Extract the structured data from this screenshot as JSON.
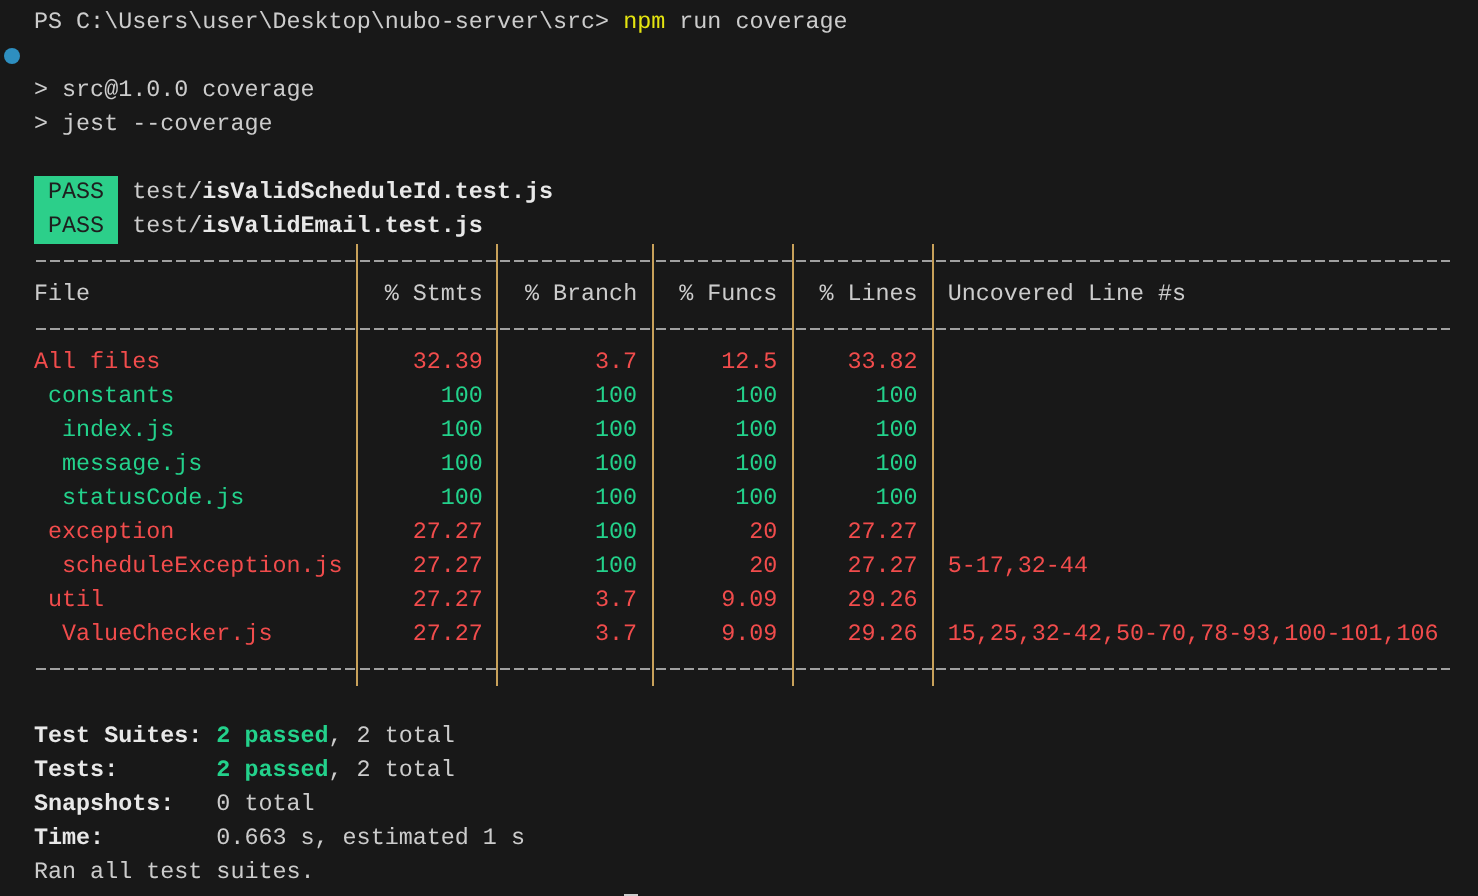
{
  "prompt": {
    "path": "PS C:\\Users\\user\\Desktop\\nubo-server\\src>",
    "command": "npm",
    "args": "run coverage"
  },
  "script_lines": [
    "> src@1.0.0 coverage",
    "> jest --coverage"
  ],
  "results": [
    {
      "badge": "PASS",
      "path": "test/**isValidScheduleId.test.js**"
    },
    {
      "badge": "PASS",
      "path": "test/**isValidEmail.test.js**"
    }
  ],
  "coverage_table": {
    "columns": [
      "File",
      "% Stmts",
      "% Branch",
      "% Funcs",
      "% Lines",
      "Uncovered Line #s"
    ],
    "rows": [
      {
        "cells": [
          {
            "text": "All files",
            "color": "#f14c4c"
          },
          {
            "text": "32.39",
            "color": "#f14c4c"
          },
          {
            "text": "3.7",
            "color": "#f14c4c"
          },
          {
            "text": "12.5",
            "color": "#f14c4c"
          },
          {
            "text": "33.82",
            "color": "#f14c4c"
          }
        ],
        "children": [
          {
            "cells": [
              {
                "text": "constants",
                "color": "#23d18b"
              },
              {
                "text": "100",
                "color": "#23d18b"
              },
              {
                "text": "100",
                "color": "#23d18b"
              },
              {
                "text": "100",
                "color": "#23d18b"
              },
              {
                "text": "100",
                "color": "#23d18b"
              }
            ],
            "children": [
              {
                "cells": [
                  {
                    "text": "index.js",
                    "color": "#23d18b"
                  },
                  {
                    "text": "100",
                    "color": "#23d18b"
                  },
                  {
                    "text": "100",
                    "color": "#23d18b"
                  },
                  {
                    "text": "100",
                    "color": "#23d18b"
                  },
                  {
                    "text": "100",
                    "color": "#23d18b"
                  }
                ]
              },
              {
                "cells": [
                  {
                    "text": "message.js",
                    "color": "#23d18b"
                  },
                  {
                    "text": "100",
                    "color": "#23d18b"
                  },
                  {
                    "text": "100",
                    "color": "#23d18b"
                  },
                  {
                    "text": "100",
                    "color": "#23d18b"
                  },
                  {
                    "text": "100",
                    "color": "#23d18b"
                  }
                ]
              },
              {
                "cells": [
                  {
                    "text": "statusCode.js",
                    "color": "#23d18b"
                  },
                  {
                    "text": "100",
                    "color": "#23d18b"
                  },
                  {
                    "text": "100",
                    "color": "#23d18b"
                  },
                  {
                    "text": "100",
                    "color": "#23d18b"
                  },
                  {
                    "text": "100",
                    "color": "#23d18b"
                  }
                ]
              }
            ]
          },
          {
            "cells": [
              {
                "text": "exception",
                "color": "#f14c4c"
              },
              {
                "text": "27.27",
                "color": "#f14c4c"
              },
              {
                "text": "100",
                "color": "#23d18b"
              },
              {
                "text": "20",
                "color": "#f14c4c"
              },
              {
                "text": "27.27",
                "color": "#f14c4c"
              }
            ],
            "children": [
              {
                "cells": [
                  {
                    "text": "scheduleException.js",
                    "color": "#f14c4c"
                  },
                  {
                    "text": "27.27",
                    "color": "#f14c4c"
                  },
                  {
                    "text": "100",
                    "color": "#23d18b"
                  },
                  {
                    "text": "20",
                    "color": "#f14c4c"
                  },
                  {
                    "text": "27.27",
                    "color": "#f14c4c"
                  },
                  {
                    "text": "5-17,32-44",
                    "color": "#f14c4c"
                  }
                ]
              }
            ]
          },
          {
            "cells": [
              {
                "text": "util",
                "color": "#f14c4c"
              },
              {
                "text": "27.27",
                "color": "#f14c4c"
              },
              {
                "text": "3.7",
                "color": "#f14c4c"
              },
              {
                "text": "9.09",
                "color": "#f14c4c"
              },
              {
                "text": "29.26",
                "color": "#f14c4c"
              }
            ],
            "children": [
              {
                "cells": [
                  {
                    "text": "ValueChecker.js",
                    "color": "#f14c4c"
                  },
                  {
                    "text": "27.27",
                    "color": "#f14c4c"
                  },
                  {
                    "text": "3.7",
                    "color": "#f14c4c"
                  },
                  {
                    "text": "9.09",
                    "color": "#f14c4c"
                  },
                  {
                    "text": "29.26",
                    "color": "#f14c4c"
                  },
                  {
                    "text": "15,25,32-42,50-70,78-93,100-101,106",
                    "color": "#f14c4c"
                  }
                ]
              }
            ]
          }
        ]
      }
    ]
  },
  "summary": [
    {
      "label": "Test Suites:",
      "passed": "2 passed",
      "rest": ", 2 total"
    },
    {
      "label": "Tests:",
      "passed": "2 passed",
      "rest": ", 2 total"
    },
    {
      "label": "Snapshots:",
      "rest": "0 total"
    },
    {
      "label": "Time:",
      "rest": "0.663 s, estimated 1 s"
    }
  ],
  "footer": "Ran all test suites."
}
